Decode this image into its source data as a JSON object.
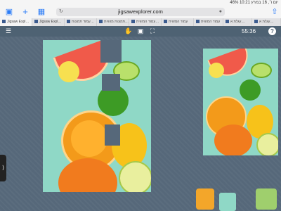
{
  "status": {
    "left": "",
    "right": "יום ו׳, 16 במרץ   10:21   46%"
  },
  "browser": {
    "url": "jigsawexplorer.com",
    "tabs": [
      "Jigsaw Expl…",
      "Jigsaw Expl…",
      "עמוד תמונות…",
      "תמונות מזוויות…",
      "עמוד המזווית…",
      "עמוד המזווית",
      "עמוד המזווית",
      "עגלת א…",
      "עגלת א…"
    ]
  },
  "toolbar": {
    "timer": "55:36",
    "help": "?"
  },
  "icons": [
    "sidebar-icon",
    "add-tab-icon",
    "tabs-overview-icon",
    "hand-icon",
    "image-icon",
    "fullscreen-icon",
    "menu-icon",
    "help-icon"
  ],
  "colors": {
    "board": "#56687a",
    "toolbar": "#4e6273",
    "piece_bg": "#8fd8c6",
    "accent": "#2b7cf7"
  }
}
